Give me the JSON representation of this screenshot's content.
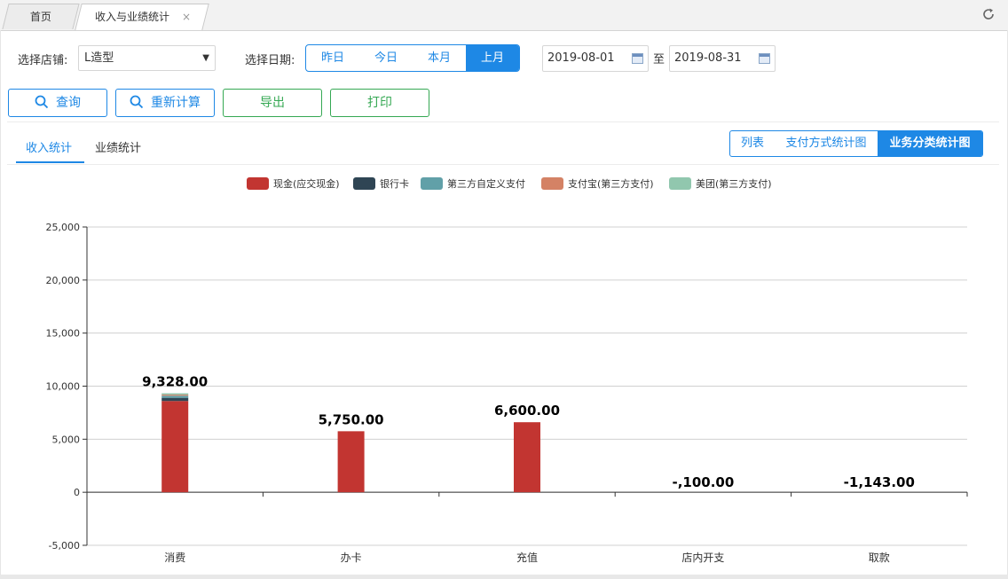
{
  "tabs": {
    "home": "首页",
    "active": "收入与业绩统计",
    "close": "×"
  },
  "filters": {
    "store_label": "选择店铺:",
    "store_value": "L造型",
    "date_label": "选择日期:",
    "quick_dates": [
      "昨日",
      "今日",
      "本月",
      "上月"
    ],
    "quick_active": 3,
    "date_from": "2019-08-01",
    "date_sep": "至",
    "date_to": "2019-08-31"
  },
  "buttons": {
    "query": "查询",
    "recalc": "重新计算",
    "export": "导出",
    "print": "打印"
  },
  "subtabs": [
    "收入统计",
    "业绩统计"
  ],
  "views": [
    "列表",
    "支付方式统计图",
    "业务分类统计图"
  ],
  "view_active": 2,
  "colors": {
    "accent": "#1e88e5",
    "green": "#35a853"
  },
  "chart_data": {
    "type": "bar",
    "stacked": true,
    "categories": [
      "消费",
      "办卡",
      "充值",
      "店内开支",
      "取款"
    ],
    "series": [
      {
        "name": "现金(应交现金)",
        "color": "#c23531",
        "values": [
          8600,
          5750,
          6600,
          0,
          0
        ]
      },
      {
        "name": "银行卡",
        "color": "#2f4554",
        "values": [
          300,
          0,
          0,
          0,
          0
        ]
      },
      {
        "name": "第三方自定义支付",
        "color": "#61a0a8",
        "values": [
          200,
          0,
          0,
          0,
          0
        ]
      },
      {
        "name": "支付宝(第三方支付)",
        "color": "#d48265",
        "values": [
          100,
          0,
          0,
          0,
          0
        ]
      },
      {
        "name": "美团(第三方支付)",
        "color": "#91c7ae",
        "values": [
          128,
          0,
          0,
          0,
          0
        ]
      }
    ],
    "totals": [
      "9,328.00",
      "5,750.00",
      "6,600.00",
      "-,100.00",
      "-1,143.00"
    ],
    "yticks": [
      "25,000",
      "20,000",
      "15,000",
      "10,000",
      "5,000",
      "0",
      "-5,000"
    ],
    "ylim": [
      -5000,
      25000
    ],
    "grid": true,
    "legend": "top"
  }
}
